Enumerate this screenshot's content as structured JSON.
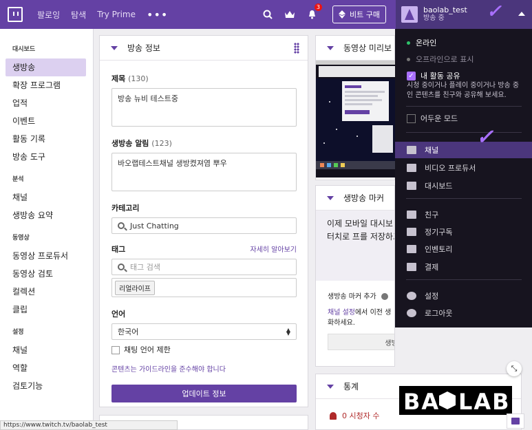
{
  "nav": {
    "links": [
      "팔로잉",
      "탐색",
      "Try Prime"
    ],
    "more": "•••",
    "notification_count": "3",
    "bits_label": "비트 구매",
    "user_name": "baolab_test",
    "user_status": "방송 중",
    "brand_color": "#6441a4"
  },
  "sidebar": {
    "sections": [
      {
        "title": "대시보드",
        "items": [
          "생방송",
          "확장 프로그램",
          "업적",
          "이벤트",
          "활동 기록",
          "방송 도구"
        ]
      },
      {
        "title": "분석",
        "items": [
          "채널",
          "생방송 요약"
        ]
      },
      {
        "title": "동영상",
        "items": [
          "동영상 프로듀서",
          "동영상 검토",
          "컬렉션",
          "클립"
        ]
      },
      {
        "title": "설정",
        "items": [
          "채널",
          "역할",
          "검토기능"
        ]
      }
    ],
    "active": "생방송"
  },
  "stream_info": {
    "title": "방송 정보",
    "title_label": "제목",
    "title_count": "(130)",
    "title_value": "방송 뉴비 테스트중",
    "notify_label": "생방송 알림",
    "notify_count": "(123)",
    "notify_value": "바오랩테스트채널 생방켰져염 뿌우",
    "category_label": "카테고리",
    "category_value": "Just Chatting",
    "tags_label": "태그",
    "tags_link": "자세히 알아보기",
    "tags_placeholder": "태그 검색",
    "tag": "리얼라이프",
    "lang_label": "언어",
    "lang_value": "한국어",
    "chat_restrict": "채팅 언어 제한",
    "guideline": "콘텐츠는 가이드라인을 준수해야 합니다",
    "update_button": "업데이트 정보"
  },
  "preview": {
    "title": "동영상 미리보"
  },
  "markers": {
    "title": "생방송 마커",
    "body": "이제 모바일 대시보 방송 마커를 이용할 다. 한 번의 터치로 프를 저장하고 설명 세요.",
    "add_label": "생방송 마커 추가",
    "channel_settings_link": "채널 설정",
    "channel_text": "에서 이전 생",
    "channel_text2": "화하세요.",
    "disable_button": "생방송 마커 비활성화"
  },
  "stats": {
    "title": "통계",
    "viewers": "0 시청자 수"
  },
  "dropdown": {
    "online": "온라인",
    "offline": "오프라인으로 표시",
    "share_label": "내 활동 공유",
    "share_desc": "시청 중이거나 플레이 중이거나 방송 중인 콘텐츠를 친구와 공유해 보세요.",
    "dark_mode": "어두운 모드",
    "items": [
      "채널",
      "비디오 프로듀서",
      "대시보드",
      "친구",
      "정기구독",
      "인벤토리",
      "결제",
      "설정",
      "로그아웃"
    ]
  },
  "status_url": "https://www.twitch.tv/baolab_test",
  "watermark": "BAOLAB"
}
